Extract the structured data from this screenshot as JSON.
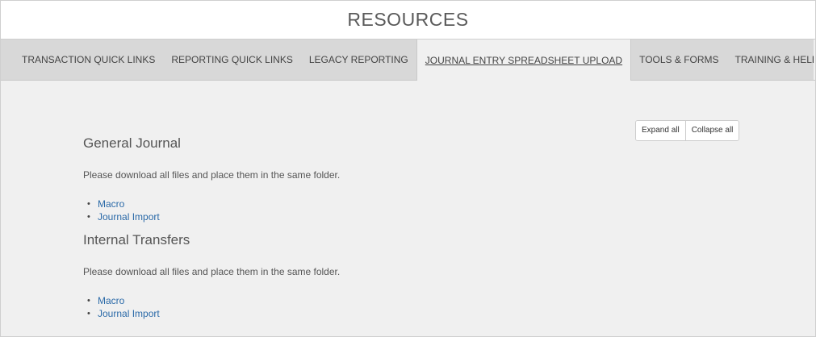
{
  "header": {
    "title": "RESOURCES"
  },
  "tabs": [
    {
      "label": "TRANSACTION QUICK LINKS"
    },
    {
      "label": "REPORTING QUICK LINKS"
    },
    {
      "label": "LEGACY REPORTING"
    },
    {
      "label": "JOURNAL ENTRY SPREADSHEET UPLOAD",
      "active": true
    },
    {
      "label": "TOOLS & FORMS"
    },
    {
      "label": "TRAINING & HELP"
    }
  ],
  "controls": {
    "expand_all": "Expand all",
    "collapse_all": "Collapse all"
  },
  "sections": [
    {
      "title": "General Journal",
      "description": "Please download all files and place them in the same folder.",
      "links": [
        "Macro",
        "Journal Import"
      ]
    },
    {
      "title": "Internal Transfers",
      "description": "Please download all files and place them in the same folder.",
      "links": [
        "Macro",
        "Journal Import"
      ]
    }
  ],
  "colors": {
    "link": "#2b6aa8",
    "tab_bar": "#d8d8d8",
    "content_bg": "#f0f0f0"
  }
}
